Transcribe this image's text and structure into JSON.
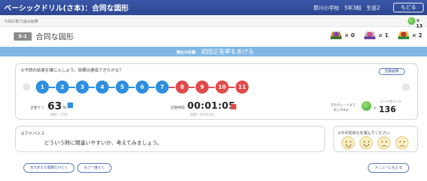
{
  "header": {
    "title": "ベーシックドリル(さ本)：合同な図形",
    "school": "祭川小学校　5年3組　生徒2",
    "back_label": "もどる"
  },
  "crumb": "今回の取り組み結果",
  "points": "× 13",
  "lesson": {
    "badge": "5-1",
    "title": "合同な図形"
  },
  "medals": [
    {
      "name": "bronze-medal",
      "color": "#c98a2a",
      "value": "× 0"
    },
    {
      "name": "silver-medal",
      "color": "#b9b9b9",
      "value": "× 1"
    },
    {
      "name": "gold-medal",
      "color": "#e3c23a",
      "value": "× 2"
    }
  ],
  "goal": {
    "label": "現在の目標：",
    "text": "初回正答率をあげる"
  },
  "result": {
    "question": "①今回の結果を確にんしよう。目標は達成できたかな？",
    "history_button": "回答結果",
    "prev_icon": "‹",
    "next_icon": "›",
    "steps": [
      "1",
      "2",
      "3",
      "4",
      "5",
      "6",
      "7",
      "8",
      "9",
      "10",
      "11"
    ],
    "accuracy_label": "正答りつ",
    "accuracy_value": "63",
    "accuracy_unit": "%",
    "accuracy_prev": "（前回：27%）",
    "time_label": "回答時間",
    "time_value": "00:01:05",
    "time_prev": "（前回：00:00:42）",
    "grade_label1": "次のグレードまで",
    "grade_label2": "あと264pt",
    "seed_label": "シードポイント",
    "seed_x": "×",
    "seed_value": "136"
  },
  "advice": {
    "heading": "②アドバイス",
    "text": "どういう時に間違いやすいか、考えてみましょう。"
  },
  "feeling": {
    "heading": "③今の気持ちを選んでください"
  },
  "buttons": {
    "retry_wrong": "まちがえた問題だけとく",
    "retry_all": "もう一度とく",
    "menu": "メニューにもどる"
  }
}
